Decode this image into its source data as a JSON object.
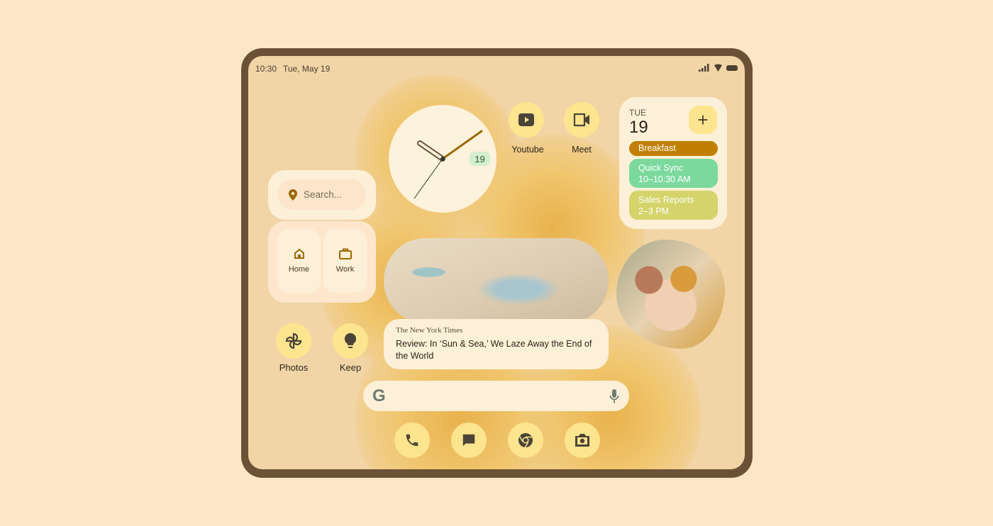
{
  "status_bar": {
    "time": "10:30",
    "date": "Tue, May 19",
    "icons": [
      "signal-icon",
      "wifi-icon",
      "battery-icon"
    ]
  },
  "clock": {
    "date_badge": "19",
    "time": "10:30"
  },
  "apps": {
    "youtube": {
      "label": "Youtube",
      "icon": "youtube-icon"
    },
    "meet": {
      "label": "Meet",
      "icon": "video-camera-icon"
    },
    "photos": {
      "label": "Photos",
      "icon": "pinwheel-icon"
    },
    "keep": {
      "label": "Keep",
      "icon": "lightbulb-icon"
    }
  },
  "calendar": {
    "day": "TUE",
    "date": "19",
    "add_label": "+",
    "events": [
      {
        "title": "Breakfast",
        "time": "",
        "color": "#c07f00"
      },
      {
        "title": "Quick Sync",
        "time": "10–10:30 AM",
        "color": "#7bd99e"
      },
      {
        "title": "Sales Reports",
        "time": "2–3 PM",
        "color": "#d4d46a"
      }
    ]
  },
  "maps": {
    "search_placeholder": "Search...",
    "shortcuts": [
      {
        "label": "Home",
        "icon": "home-icon"
      },
      {
        "label": "Work",
        "icon": "briefcase-icon"
      }
    ]
  },
  "news": {
    "source": "The New York Times",
    "headline": "Review: In ‘Sun & Sea,’ We Laze Away the End of the World"
  },
  "google_bar": {
    "logo": "G",
    "icon": "microphone-icon"
  },
  "dock": [
    {
      "icon": "phone-icon"
    },
    {
      "icon": "messages-icon"
    },
    {
      "icon": "chrome-icon"
    },
    {
      "icon": "camera-icon"
    }
  ],
  "colors": {
    "accent": "#fde48e",
    "surface": "#fdf0d8",
    "wallpaper": "#f1d5a7",
    "frame": "#6b5237"
  }
}
